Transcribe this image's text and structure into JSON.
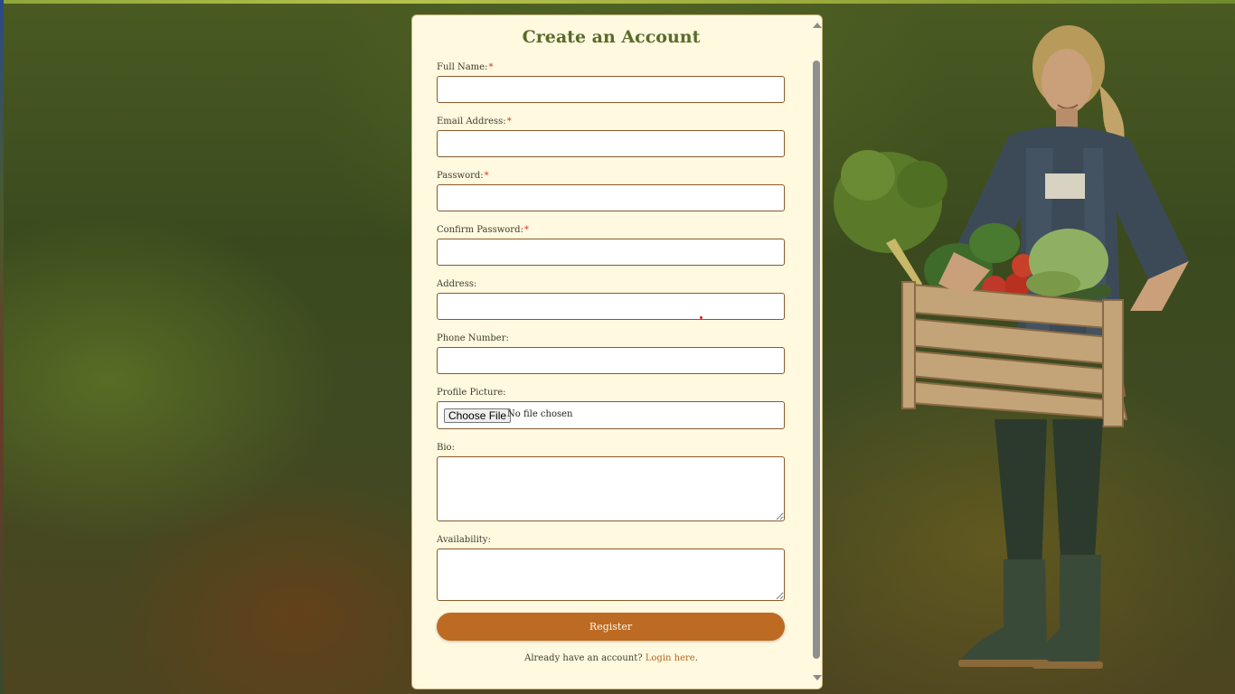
{
  "form": {
    "title": "Create an Account",
    "required_marker": "*",
    "fields": {
      "full_name": {
        "label": "Full Name:",
        "value": ""
      },
      "email": {
        "label": "Email Address:",
        "value": ""
      },
      "password": {
        "label": "Password:",
        "value": ""
      },
      "confirm_password": {
        "label": "Confirm Password:",
        "value": ""
      },
      "address": {
        "label": "Address:",
        "value": ""
      },
      "phone": {
        "label": "Phone Number:",
        "value": ""
      },
      "profile_picture": {
        "label": "Profile Picture:",
        "button_label": "Choose File",
        "status": "No file chosen"
      },
      "bio": {
        "label": "Bio:",
        "value": ""
      },
      "availability": {
        "label": "Availability:",
        "value": ""
      }
    },
    "register_label": "Register",
    "login_prompt": "Already have an account?",
    "login_link": "Login here",
    "login_suffix": "."
  },
  "colors": {
    "panel_background": "#fff9e0",
    "title": "#5a6b2a",
    "button": "#bd6a22",
    "link": "#b4651f",
    "required": "#d2342a",
    "input_border": "#8a5a2a"
  },
  "icons": {
    "scroll_up": "triangle-up",
    "scroll_down": "triangle-down",
    "background_illustration": "farmer-with-vegetable-crate"
  }
}
